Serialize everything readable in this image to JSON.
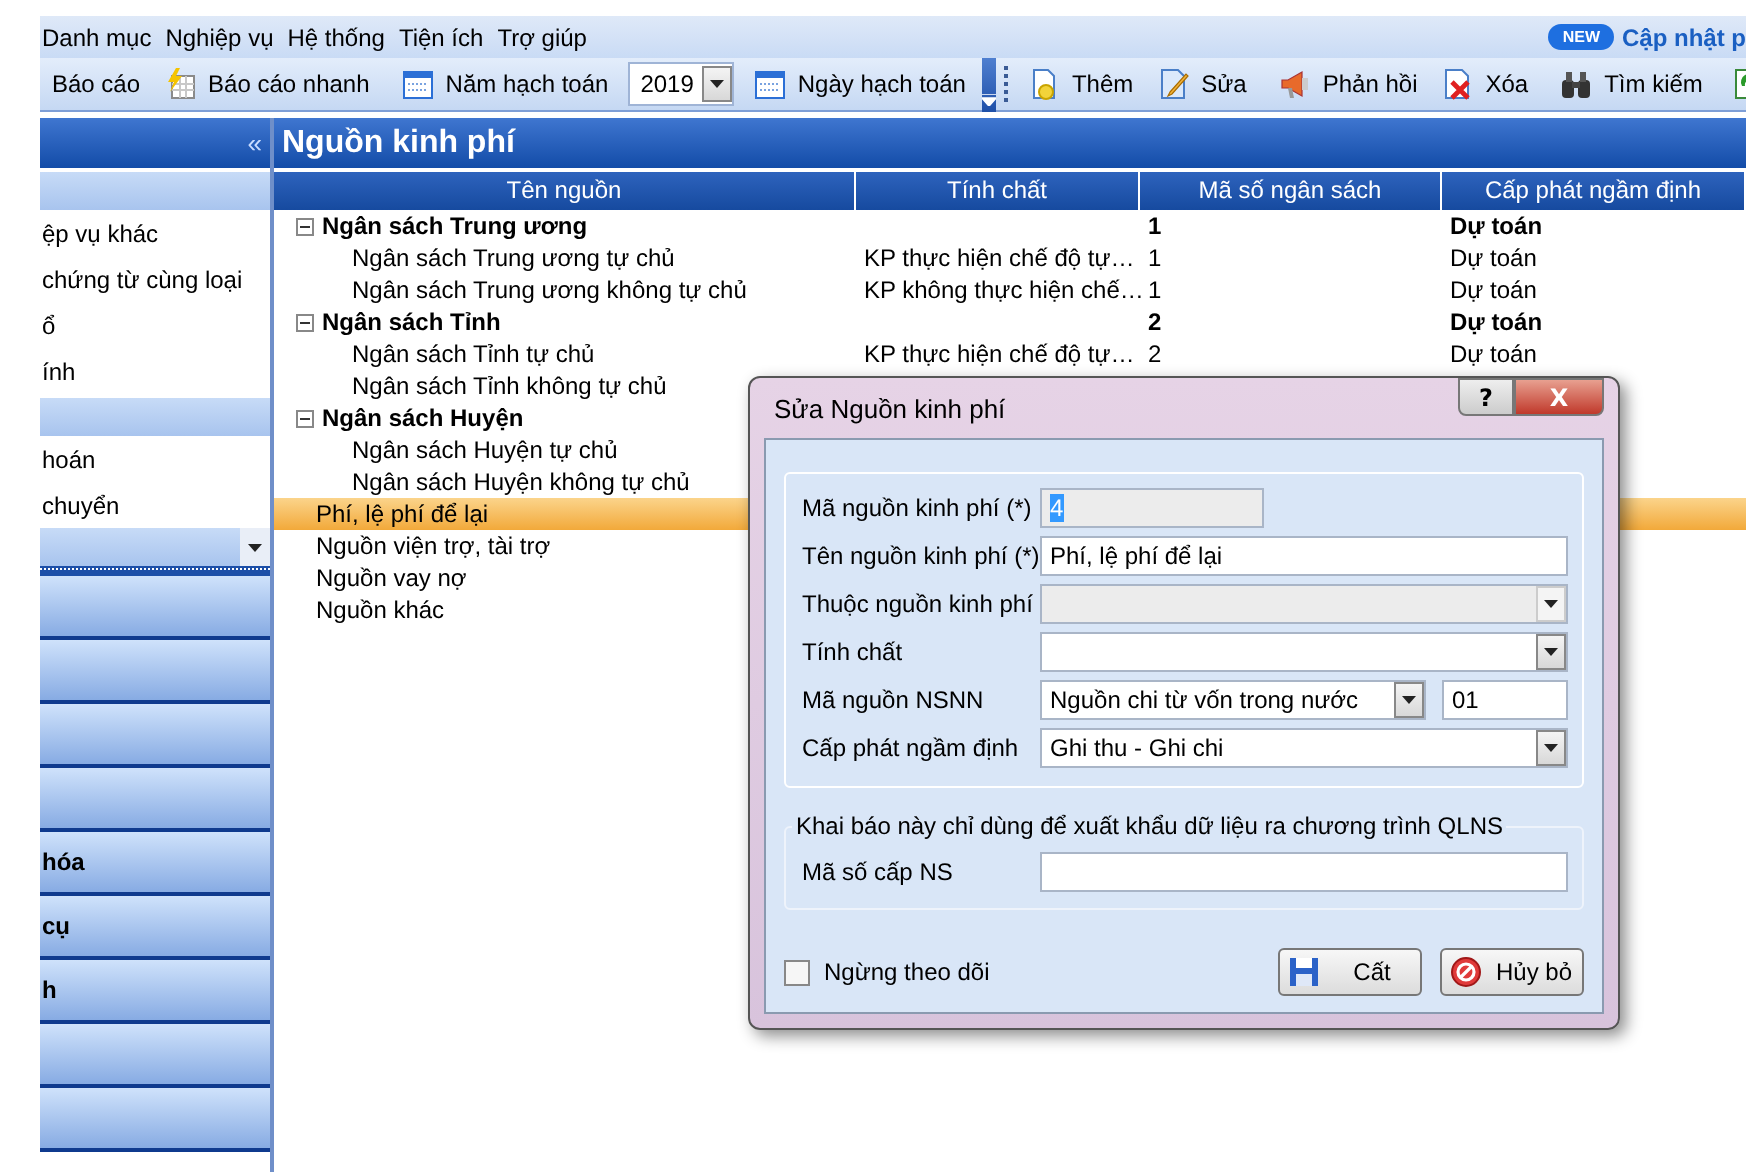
{
  "menu": [
    {
      "label": "Danh mục"
    },
    {
      "label": "Nghiệp vụ"
    },
    {
      "label": "Hệ thống"
    },
    {
      "label": "Tiện ích"
    },
    {
      "label": "Trợ giúp"
    }
  ],
  "update_badge": {
    "badge": "NEW",
    "label": "Cập nhật p"
  },
  "toolbar": [
    {
      "kind": "report",
      "label": "Báo cáo"
    },
    {
      "kind": "quickreport",
      "label": "Báo cáo nhanh"
    },
    {
      "kind": "separator"
    },
    {
      "kind": "date",
      "label": "Năm hạch toán"
    },
    {
      "kind": "combo",
      "value": "2019"
    },
    {
      "kind": "date",
      "label": "Ngày hạch toán"
    },
    {
      "kind": "overflow"
    },
    {
      "kind": "grip"
    },
    {
      "kind": "add",
      "label": "Thêm"
    },
    {
      "kind": "edit",
      "label": "Sửa"
    },
    {
      "kind": "separator"
    },
    {
      "kind": "feedback",
      "label": "Phản hồi"
    },
    {
      "kind": "delete",
      "label": "Xóa"
    },
    {
      "kind": "separator"
    },
    {
      "kind": "search",
      "label": "Tìm kiếm"
    },
    {
      "kind": "separator"
    },
    {
      "kind": "refresh"
    }
  ],
  "sidebar": {
    "collapse": "«",
    "items": [
      {
        "kind": "header"
      },
      {
        "kind": "link",
        "label": "ệp vụ khác"
      },
      {
        "kind": "link",
        "label": "chứng từ cùng loại"
      },
      {
        "kind": "link",
        "label": "ổ"
      },
      {
        "kind": "link",
        "label": "ính"
      },
      {
        "kind": "header"
      },
      {
        "kind": "link",
        "label": "hoán"
      },
      {
        "kind": "link",
        "label": "chuyển"
      },
      {
        "kind": "combo"
      },
      {
        "kind": "splitter"
      },
      {
        "kind": "section"
      },
      {
        "kind": "section"
      },
      {
        "kind": "section"
      },
      {
        "kind": "section"
      },
      {
        "kind": "section",
        "label": "hóa"
      },
      {
        "kind": "section",
        "label": "cụ"
      },
      {
        "kind": "section",
        "label": "h"
      },
      {
        "kind": "section"
      },
      {
        "kind": "section"
      }
    ]
  },
  "page_title": "Nguồn kinh phí",
  "table": {
    "columns": [
      "Tên nguồn",
      "Tính chất",
      "Mã số ngân sách",
      "Cấp phát ngầm định"
    ],
    "rows": [
      {
        "name": "Ngân sách Trung ương",
        "expanded": true,
        "selected": false,
        "ma_so": "1",
        "cap_phat": "Dự toán",
        "children": [
          {
            "name": "Ngân sách Trung ương tự chủ",
            "selected": false,
            "tinh_chat": "KP thực hiện chế độ tự…",
            "ma_so": "1",
            "cap_phat": "Dự toán"
          },
          {
            "name": "Ngân sách Trung ương không tự chủ",
            "selected": false,
            "tinh_chat": "KP không thực hiện chế…",
            "ma_so": "1",
            "cap_phat": "Dự toán"
          }
        ]
      },
      {
        "name": "Ngân sách Tỉnh",
        "expanded": true,
        "selected": false,
        "ma_so": "2",
        "cap_phat": "Dự toán",
        "children": [
          {
            "name": "Ngân sách Tỉnh tự chủ",
            "selected": false,
            "tinh_chat": "KP thực hiện chế độ tự…",
            "ma_so": "2",
            "cap_phat": "Dự toán"
          },
          {
            "name": "Ngân sách Tỉnh không tự chủ",
            "selected": false
          }
        ]
      },
      {
        "name": "Ngân sách Huyện",
        "expanded": true,
        "selected": false,
        "children": [
          {
            "name": "Ngân sách Huyện tự chủ",
            "selected": false
          },
          {
            "name": "Ngân sách Huyện không tự chủ",
            "selected": false
          }
        ]
      },
      {
        "name": "Phí, lệ phí để lại",
        "selected": true
      },
      {
        "name": "Nguồn viện trợ, tài trợ",
        "selected": false
      },
      {
        "name": "Nguồn vay nợ",
        "selected": false
      },
      {
        "name": "Nguồn khác",
        "selected": false
      }
    ]
  },
  "dialog": {
    "title": "Sửa Nguồn kinh phí",
    "help": "?",
    "close": "X",
    "fields": [
      {
        "kind": "text",
        "label": "Mã nguồn kinh phí (*)",
        "value": "4",
        "disabled": true
      },
      {
        "kind": "text",
        "label": "Tên nguồn kinh phí (*)",
        "value": "Phí, lệ phí để lại",
        "disabled": false
      },
      {
        "kind": "combo",
        "label": "Thuộc nguồn kinh phí",
        "disabled": true
      },
      {
        "kind": "combo",
        "label": "Tính chất",
        "disabled": false
      },
      {
        "kind": "combo_code",
        "label": "Mã nguồn NSNN",
        "value": "Nguồn chi từ vốn trong nước",
        "code": "01",
        "disabled": false
      },
      {
        "kind": "combo",
        "label": "Cấp phát ngầm định",
        "value": "Ghi thu - Ghi chi",
        "disabled": false
      }
    ],
    "export_group": {
      "legend": "Khai báo này chỉ dùng để xuất khẩu dữ liệu ra chương trình QLNS",
      "fields": [
        {
          "kind": "text",
          "label": "Mã số cấp NS",
          "disabled": false
        }
      ]
    },
    "stop_tracking": {
      "label": "Ngừng theo dõi",
      "checked": false
    },
    "buttons": [
      {
        "kind": "save",
        "label": "Cất"
      },
      {
        "kind": "cancel",
        "label": "Hủy bỏ"
      }
    ]
  }
}
